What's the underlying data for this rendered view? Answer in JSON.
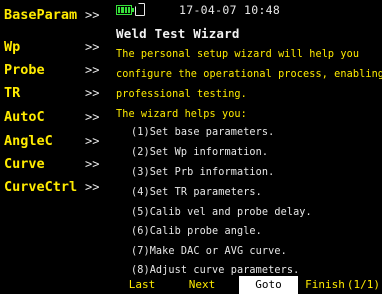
{
  "sidebar": {
    "items": [
      {
        "label": "BaseParam",
        "arrow": ">>"
      },
      {
        "label": "Wp",
        "arrow": ">>"
      },
      {
        "label": "Probe",
        "arrow": ">>"
      },
      {
        "label": "TR",
        "arrow": ">>"
      },
      {
        "label": "AutoC",
        "arrow": ">>"
      },
      {
        "label": "AngleC",
        "arrow": ">>"
      },
      {
        "label": "Curve",
        "arrow": ">>"
      },
      {
        "label": "CurveCtrl",
        "arrow": ">>"
      }
    ]
  },
  "status": {
    "datetime": "17-04-07 10:48",
    "battery_level": 1.0
  },
  "wizard": {
    "title": "Weld Test Wizard",
    "description": [
      "The personal setup wizard will help you",
      "configure the operational process, enabling",
      "professional testing.",
      "The wizard helps you:"
    ],
    "steps": [
      "(1)Set base parameters.",
      "(2)Set Wp information.",
      "(3)Set Prb information.",
      "(4)Set TR parameters.",
      "(5)Calib vel and probe delay.",
      "(6)Calib probe angle.",
      "(7)Make DAC or AVG curve.",
      "(8)Adjust curve parameters."
    ]
  },
  "bottom": {
    "buttons": [
      {
        "label": "Last"
      },
      {
        "label": "Next"
      },
      {
        "label": "Goto"
      },
      {
        "label": "Finish"
      }
    ],
    "page": "(1/1)"
  },
  "colors": {
    "background": "#000000",
    "sidebar_text": "#ffeb00",
    "accent_text": "#ffeb00",
    "normal_text": "#e8e8e8",
    "battery": "#37e03a",
    "active_button_bg": "#ffffff"
  }
}
